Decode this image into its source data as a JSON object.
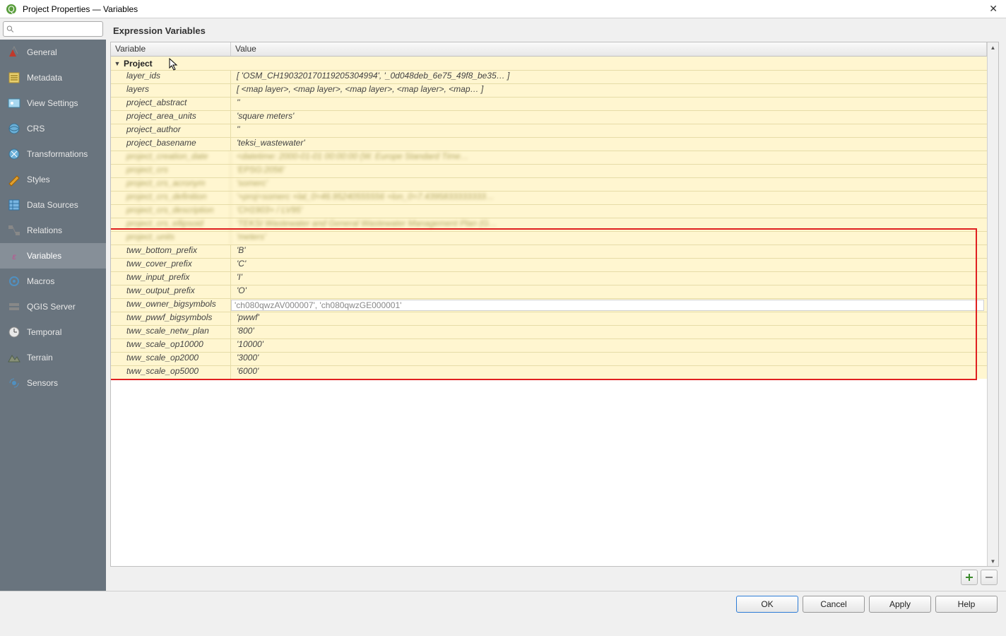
{
  "window": {
    "title": "Project Properties — Variables",
    "close": "✕"
  },
  "search": {
    "placeholder": ""
  },
  "sidebar": {
    "items": [
      {
        "label": "General"
      },
      {
        "label": "Metadata"
      },
      {
        "label": "View Settings"
      },
      {
        "label": "CRS"
      },
      {
        "label": "Transformations"
      },
      {
        "label": "Styles"
      },
      {
        "label": "Data Sources"
      },
      {
        "label": "Relations"
      },
      {
        "label": "Variables"
      },
      {
        "label": "Macros"
      },
      {
        "label": "QGIS Server"
      },
      {
        "label": "Temporal"
      },
      {
        "label": "Terrain"
      },
      {
        "label": "Sensors"
      }
    ],
    "selected_index": 8
  },
  "main": {
    "title": "Expression Variables",
    "columns": {
      "variable": "Variable",
      "value": "Value"
    },
    "group": "Project",
    "rows": [
      {
        "name": "layer_ids",
        "value": "[ 'OSM_CH190320170119205304994', '_0d048deb_6e75_49f8_be35… ]"
      },
      {
        "name": "layers",
        "value": "[ <map layer>, <map layer>, <map layer>, <map layer>, <map… ]"
      },
      {
        "name": "project_abstract",
        "value": "''"
      },
      {
        "name": "project_area_units",
        "value": "'square meters'"
      },
      {
        "name": "project_author",
        "value": "''"
      },
      {
        "name": "project_basename",
        "value": "'teksi_wastewater'"
      },
      {
        "name": "project_creation_date",
        "value": "<datetime: 2000-01-01 00:00:00 (W. Europe Standard Time…",
        "blur": true
      },
      {
        "name": "project_crs",
        "value": "'EPSG:2056'",
        "blur": true
      },
      {
        "name": "project_crs_acronym",
        "value": "'somerc'",
        "blur": true
      },
      {
        "name": "project_crs_definition",
        "value": "'+proj=somerc +lat_0=46.95240555556 +lon_0=7.4395833333333…",
        "blur": true
      },
      {
        "name": "project_crs_description",
        "value": "'CH1903+ / LV95'",
        "blur": true
      },
      {
        "name": "project_crs_ellipsoid",
        "value": "'TEKSI Wastewater and General Wastewater Management Plan (G…",
        "blur": true
      },
      {
        "name": "project_units",
        "value": "'meters'",
        "blur": true
      },
      {
        "name": "tww_bottom_prefix",
        "value": "'B'"
      },
      {
        "name": "tww_cover_prefix",
        "value": "'C'"
      },
      {
        "name": "tww_input_prefix",
        "value": "'I'"
      },
      {
        "name": "tww_output_prefix",
        "value": "'O'"
      },
      {
        "name": "tww_owner_bigsymbols",
        "value": "'ch080qwzAV000007', 'ch080qwzGE000001'",
        "editable": true
      },
      {
        "name": "tww_pwwf_bigsymbols",
        "value": "'pwwf'"
      },
      {
        "name": "tww_scale_netw_plan",
        "value": "'800'"
      },
      {
        "name": "tww_scale_op10000",
        "value": "'10000'"
      },
      {
        "name": "tww_scale_op2000",
        "value": "'3000'"
      },
      {
        "name": "tww_scale_op5000",
        "value": "'6000'"
      }
    ]
  },
  "footer": {
    "ok": "OK",
    "cancel": "Cancel",
    "apply": "Apply",
    "help": "Help"
  },
  "toolbar": {
    "add_tip": "+",
    "remove_tip": "−"
  }
}
